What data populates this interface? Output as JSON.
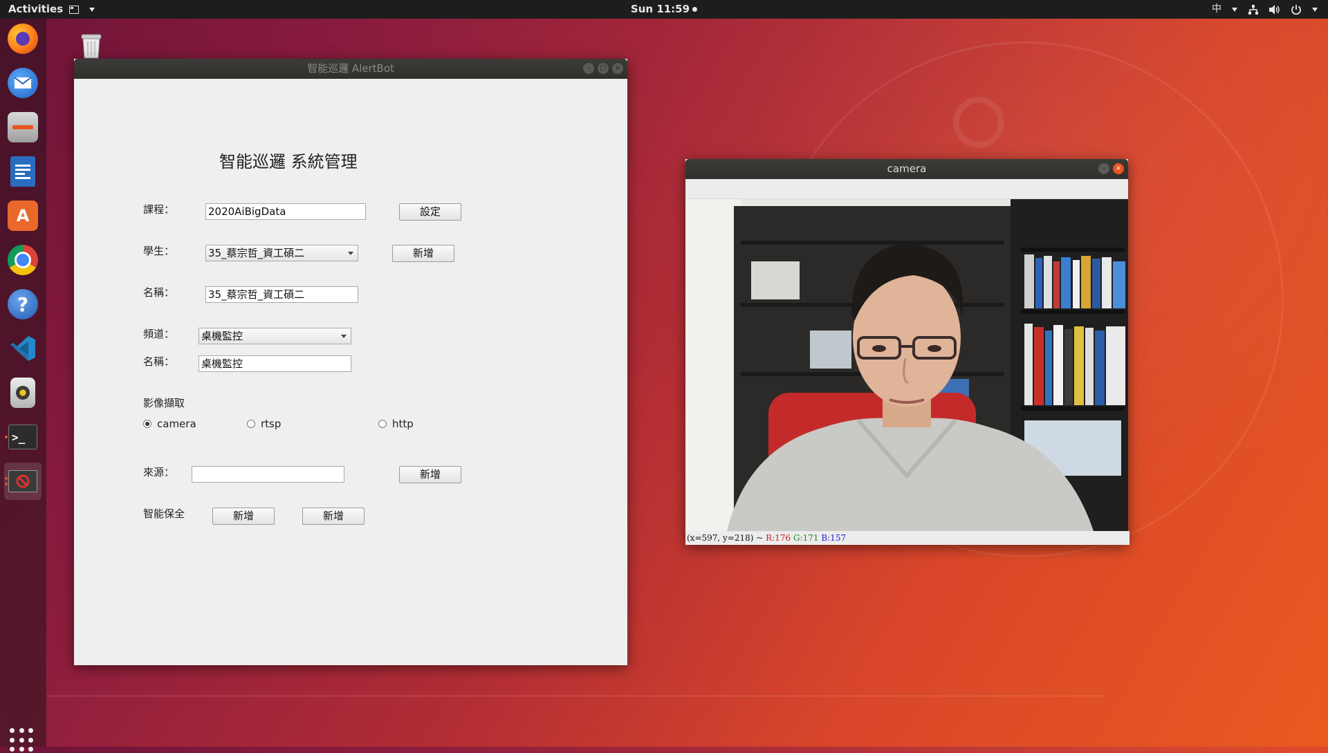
{
  "topbar": {
    "activities": "Activities",
    "clock": "Sun 11:59",
    "input_method": "中",
    "icons": [
      "window-menu-icon",
      "chevron-down-icon",
      "network-icon",
      "volume-icon",
      "power-icon"
    ]
  },
  "dock": {
    "apps": [
      "firefox-icon",
      "thunderbird-icon",
      "files-icon",
      "writer-icon",
      "software-icon",
      "chrome-icon",
      "help-icon",
      "vscode-icon",
      "rhythmbox-icon",
      "terminal-icon",
      "alertbot-icon"
    ]
  },
  "main_window": {
    "title": "智能巡邏 AlertBot",
    "heading": "智能巡邏  系統管理",
    "course_label": "課程：",
    "course_value": "2020AiBigData",
    "set_button": "設定",
    "student_label": "學生：",
    "student_value": "35_蔡宗哲_資工碩二",
    "student_add_button": "新增",
    "name_label": "名稱：",
    "name_value": "35_蔡宗哲_資工碩二",
    "channel_label": "頻道：",
    "channel_value": "桌機監控",
    "channel_name_label": "名稱：",
    "channel_name_value": "桌機監控",
    "capture_label": "影像擷取",
    "radio_camera": "camera",
    "radio_rtsp": "rtsp",
    "radio_http": "http",
    "selected_source_type": "camera",
    "source_label": "來源：",
    "source_value": "",
    "source_add_button": "新增",
    "guard_label": "智能保全",
    "guard_button_1": "新增",
    "guard_button_2": "新增"
  },
  "camera_window": {
    "title": "camera",
    "status_prefix": "(x=597, y=218) ~",
    "status_r": "R:176",
    "status_g": "G:171",
    "status_b": "B:157"
  },
  "colors": {
    "accent": "#e95420",
    "topbar": "#1d1d1d",
    "titlebar": "#353431"
  }
}
